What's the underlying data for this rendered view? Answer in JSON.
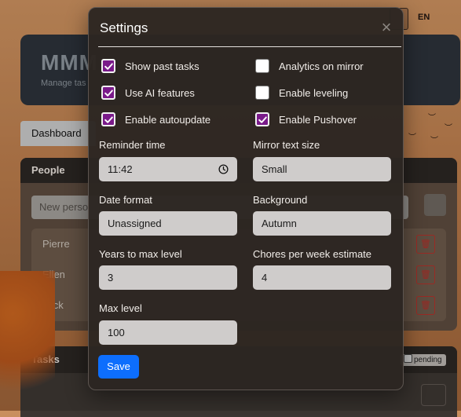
{
  "background": {
    "language": "EN",
    "hero": {
      "title": "MMM",
      "subtitle": "Manage tas"
    },
    "tab_dashboard": "Dashboard",
    "people": {
      "title": "People",
      "new_person_placeholder": "New perso",
      "persons": [
        "Pierre",
        "Ellen",
        "Jack"
      ]
    },
    "tasks": {
      "title": "Tasks",
      "pending_label": "pending"
    }
  },
  "modal": {
    "title": "Settings",
    "checkboxes": [
      {
        "label": "Show past tasks",
        "checked": true
      },
      {
        "label": "Analytics on mirror",
        "checked": false
      },
      {
        "label": "Use AI features",
        "checked": true
      },
      {
        "label": "Enable leveling",
        "checked": false
      },
      {
        "label": "Enable autoupdate",
        "checked": true
      },
      {
        "label": "Enable Pushover",
        "checked": true
      }
    ],
    "fields": {
      "reminder_time": {
        "label": "Reminder time",
        "value": "11:42"
      },
      "mirror_text_size": {
        "label": "Mirror text size",
        "value": "Small"
      },
      "date_format": {
        "label": "Date format",
        "value": "Unassigned"
      },
      "background": {
        "label": "Background",
        "value": "Autumn"
      },
      "years_to_max_level": {
        "label": "Years to max level",
        "value": "3"
      },
      "chores_per_week": {
        "label": "Chores per week estimate",
        "value": "4"
      },
      "max_level": {
        "label": "Max level",
        "value": "100"
      }
    },
    "save_label": "Save"
  },
  "colors": {
    "checkbox_checked": "#7a1a8a",
    "save_button": "#0d6efd",
    "modal_bg": "#2c2622"
  }
}
